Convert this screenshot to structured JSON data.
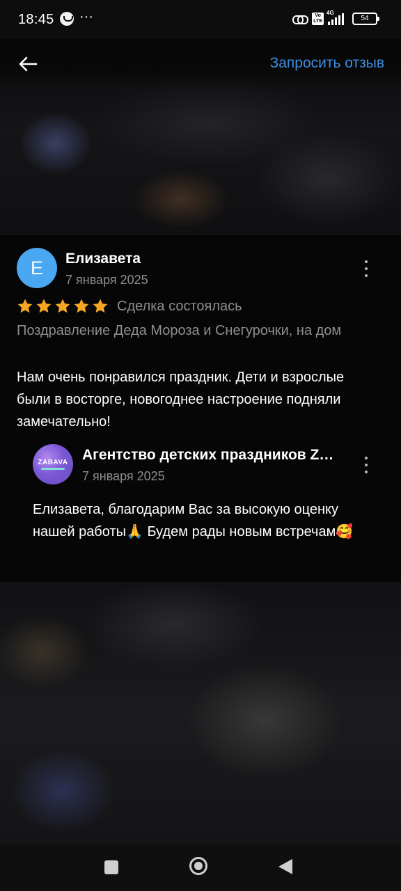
{
  "status_bar": {
    "time": "18:45",
    "more": "···",
    "volte": "Vo\nLTE",
    "network": "4G",
    "battery": "54"
  },
  "top_bar": {
    "request_review": "Запросить отзыв"
  },
  "review": {
    "avatar_letter": "Е",
    "author": "Елизавета",
    "date": "7 января 2025",
    "rating": 5,
    "rating_max": 5,
    "deal_status": "Сделка состоялась",
    "service": "Поздравление Деда Мороза и Снегурочки, на дом",
    "text": "Нам очень понравился праздник. Дети и взрослые были в восторге, новогоднее настроение подняли замечательно!"
  },
  "reply": {
    "avatar_logo": "ZABAVA",
    "author": "Агентство детских праздников ZABAVA",
    "date": "7 января 2025",
    "text": "Елизавета, благодарим Вас за высокую оценку нашей работы🙏 Будем рады новым встречам🥰"
  },
  "colors": {
    "accent": "#3d8de0",
    "star": "#f5a623",
    "avatar": "#4aa7f1",
    "secondary_text": "#8e8e8e"
  },
  "icons": {
    "back": "arrow-left-icon",
    "more": "more-vertical-icon",
    "star": "star-icon"
  }
}
